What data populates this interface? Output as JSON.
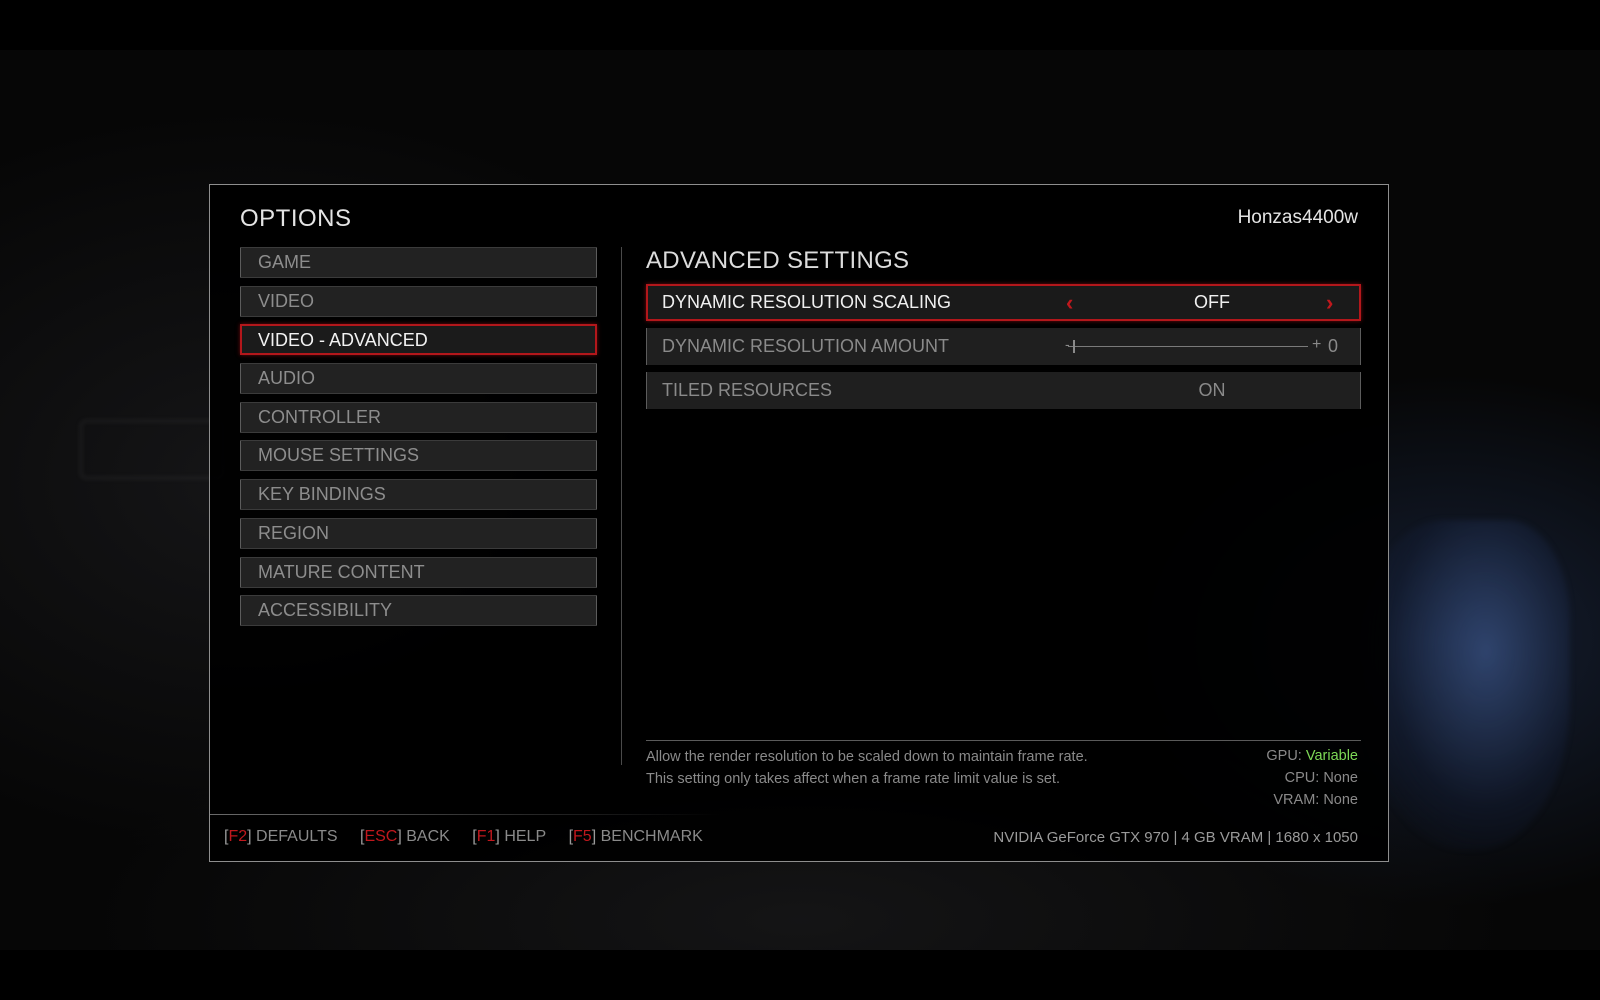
{
  "header": {
    "title": "OPTIONS",
    "username": "Honzas4400w"
  },
  "menu": {
    "items": [
      {
        "label": "GAME"
      },
      {
        "label": "VIDEO"
      },
      {
        "label": "VIDEO - ADVANCED"
      },
      {
        "label": "AUDIO"
      },
      {
        "label": "CONTROLLER"
      },
      {
        "label": "MOUSE SETTINGS"
      },
      {
        "label": "KEY BINDINGS"
      },
      {
        "label": "REGION"
      },
      {
        "label": "MATURE CONTENT"
      },
      {
        "label": "ACCESSIBILITY"
      }
    ],
    "selected": "VIDEO - ADVANCED"
  },
  "section": {
    "title": "ADVANCED SETTINGS"
  },
  "settings": [
    {
      "label": "DYNAMIC RESOLUTION SCALING",
      "value": "OFF"
    },
    {
      "label": "DYNAMIC RESOLUTION AMOUNT",
      "value": "0",
      "slider_fraction": 0.0
    },
    {
      "label": "TILED RESOURCES",
      "value": "ON"
    }
  ],
  "icons": {
    "prev": "chevron-left-icon",
    "next": "chevron-right-icon"
  },
  "description": {
    "line1": "Allow the render resolution to be scaled down to maintain frame rate.",
    "line2": "This setting only takes affect when a frame rate limit value is set."
  },
  "impact": {
    "gpu_label": "GPU:",
    "gpu_value": "Variable",
    "cpu_label": "CPU:",
    "cpu_value": "None",
    "vram_label": "VRAM:",
    "vram_value": "None"
  },
  "footer": {
    "keys": [
      {
        "key": "F2",
        "label": "DEFAULTS"
      },
      {
        "key": "ESC",
        "label": "BACK"
      },
      {
        "key": "F1",
        "label": "HELP"
      },
      {
        "key": "F5",
        "label": "BENCHMARK"
      }
    ],
    "gpu_info": "NVIDIA GeForce GTX 970 | 4 GB VRAM | 1680 x 1050"
  },
  "colors": {
    "accent_red": "#b3171b",
    "impact_green": "#7ed957"
  }
}
